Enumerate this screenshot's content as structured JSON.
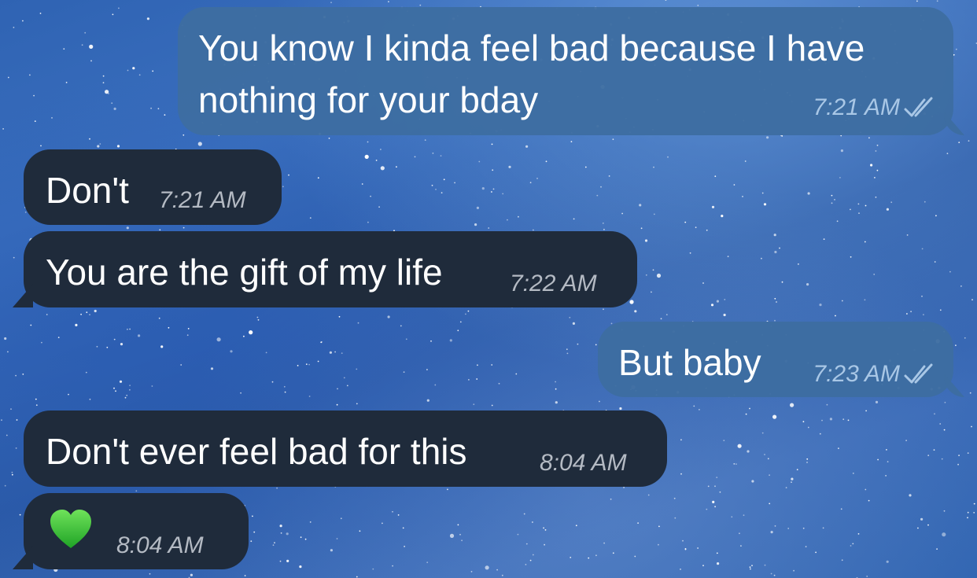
{
  "messages": [
    {
      "id": "m1",
      "direction": "out",
      "lines": [
        "You know I kinda feel bad because I have",
        "nothing for your bday"
      ],
      "time": "7:21 AM",
      "status": "read"
    },
    {
      "id": "m2",
      "direction": "in",
      "text": "Don't",
      "time": "7:21 AM"
    },
    {
      "id": "m3",
      "direction": "in",
      "text": "You are the gift of my life",
      "time": "7:22 AM"
    },
    {
      "id": "m4",
      "direction": "out",
      "text": "But baby",
      "time": "7:23 AM",
      "status": "read"
    },
    {
      "id": "m5",
      "direction": "in",
      "text": "Don't ever feel bad for this",
      "time": "8:04 AM"
    },
    {
      "id": "m6",
      "direction": "in",
      "emoji": "green-heart-icon",
      "time": "8:04 AM"
    }
  ],
  "theme": {
    "outgoing_bubble": "#3d6da1",
    "incoming_bubble": "#1f2b3b",
    "read_check": "#a9c7e6",
    "heart": "#3cc33a",
    "wallpaper": "starry-night-blue"
  }
}
